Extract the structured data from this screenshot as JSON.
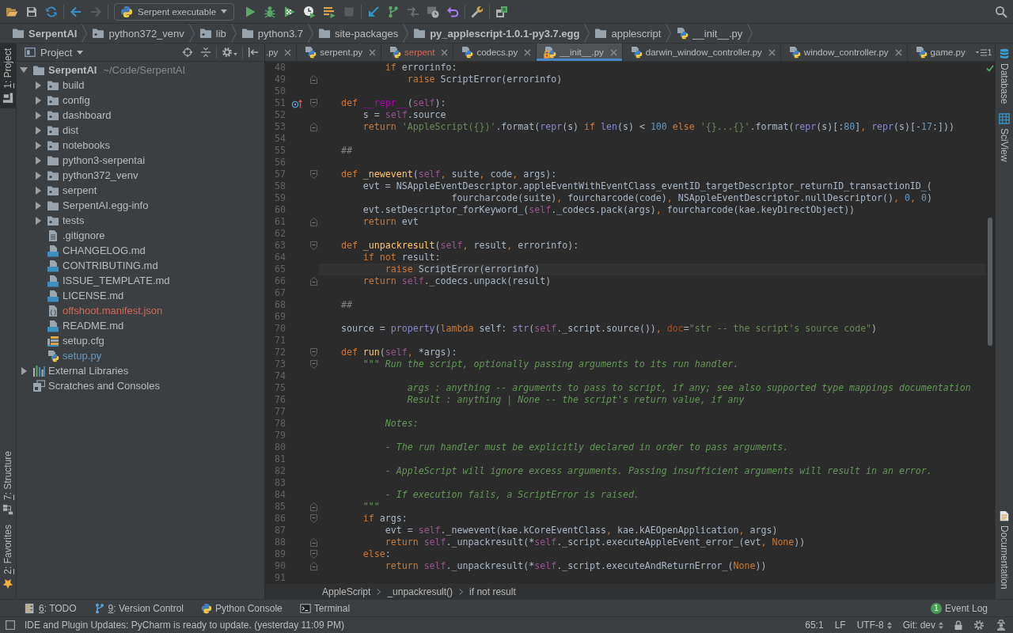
{
  "toolbar": {
    "run_configuration": "Serpent executable",
    "forward_disabled": true,
    "stop_disabled": true
  },
  "navigation_bar": [
    {
      "label": "SerpentAI",
      "kind": "root"
    },
    {
      "label": "python372_venv",
      "kind": "package"
    },
    {
      "label": "lib",
      "kind": "package"
    },
    {
      "label": "python3.7",
      "kind": "folder"
    },
    {
      "label": "site-packages",
      "kind": "folder"
    },
    {
      "label": "py_applescript-1.0.1-py3.7.egg",
      "kind": "root"
    },
    {
      "label": "applescript",
      "kind": "folder"
    },
    {
      "label": "__init__.py",
      "kind": "python"
    }
  ],
  "left_strip": {
    "top": [
      {
        "mnemonic": "1",
        "label": ": Project",
        "kind": "project",
        "selected": true
      }
    ],
    "bottom": [
      {
        "mnemonic": "7",
        "label": ": Structure",
        "kind": "structure",
        "selected": false
      },
      {
        "mnemonic": "2",
        "label": ": Favorites",
        "kind": "favorites",
        "selected": false
      }
    ]
  },
  "project_panel": {
    "title": "Project",
    "tree": [
      {
        "label": "SerpentAI",
        "path": "~/Code/SerpentAI",
        "kind": "root",
        "expanded": true,
        "children": [
          {
            "label": "build",
            "kind": "package",
            "expanded": false
          },
          {
            "label": "config",
            "kind": "package",
            "expanded": false
          },
          {
            "label": "dashboard",
            "kind": "package",
            "expanded": false
          },
          {
            "label": "dist",
            "kind": "package",
            "expanded": false
          },
          {
            "label": "notebooks",
            "kind": "package",
            "expanded": false
          },
          {
            "label": "python3-serpentai",
            "kind": "folder",
            "expanded": false
          },
          {
            "label": "python372_venv",
            "kind": "package",
            "expanded": false
          },
          {
            "label": "serpent",
            "kind": "package",
            "expanded": false
          },
          {
            "label": "SerpentAI.egg-info",
            "kind": "folder",
            "expanded": false
          },
          {
            "label": "tests",
            "kind": "package",
            "expanded": false
          },
          {
            "label": ".gitignore",
            "kind": "text"
          },
          {
            "label": "CHANGELOG.md",
            "kind": "markdown"
          },
          {
            "label": "CONTRIBUTING.md",
            "kind": "markdown"
          },
          {
            "label": "ISSUE_TEMPLATE.md",
            "kind": "markdown"
          },
          {
            "label": "LICENSE.md",
            "kind": "markdown"
          },
          {
            "label": "offshoot.manifest.json",
            "kind": "json",
            "color": "#d1675a"
          },
          {
            "label": "README.md",
            "kind": "markdown"
          },
          {
            "label": "setup.cfg",
            "kind": "config"
          },
          {
            "label": "setup.py",
            "kind": "python",
            "color": "#6897bb"
          }
        ]
      },
      {
        "label": "External Libraries",
        "kind": "libraries",
        "expanded": false
      },
      {
        "label": "Scratches and Consoles",
        "kind": "scratches"
      }
    ]
  },
  "editor": {
    "tabs": [
      {
        "label": ".py",
        "clipped": true,
        "selected": false
      },
      {
        "label": "serpent.py",
        "clipped": false,
        "selected": false,
        "read_only": false
      },
      {
        "label": "serpent",
        "clipped": false,
        "selected": false,
        "read_only": false,
        "color": "#d1675a"
      },
      {
        "label": "codecs.py",
        "clipped": false,
        "selected": false,
        "read_only": false
      },
      {
        "label": "__init__.py",
        "clipped": false,
        "selected": true,
        "read_only": true
      },
      {
        "label": "darwin_window_controller.py",
        "clipped": false,
        "selected": false,
        "read_only": false
      },
      {
        "label": "window_controller.py",
        "clipped": false,
        "selected": false,
        "read_only": false
      },
      {
        "label": "game.py",
        "clipped": false,
        "selected": false,
        "read_only": false
      }
    ],
    "hidden_tabs": "1",
    "lines": [
      {
        "number": "48",
        "current": false,
        "fold_start": false,
        "fold_end": false,
        "overrides": false,
        "tokens": [
          {
            "kind": "keyword",
            "text": "            if "
          },
          {
            "kind": "text",
            "text": "errorinfo:"
          }
        ]
      },
      {
        "number": "49",
        "current": false,
        "fold_start": false,
        "fold_end": true,
        "overrides": false,
        "tokens": [
          {
            "kind": "keyword",
            "text": "                raise "
          },
          {
            "kind": "text",
            "text": "ScriptError(errorinfo)"
          }
        ]
      },
      {
        "number": "50",
        "current": false,
        "fold_start": false,
        "fold_end": false,
        "overrides": false
      },
      {
        "number": "51",
        "current": false,
        "fold_start": true,
        "fold_end": false,
        "overrides": true,
        "tokens": [
          {
            "kind": "keyword",
            "text": "    def "
          },
          {
            "kind": "magic",
            "text": "__repr__"
          },
          {
            "kind": "text",
            "text": "("
          },
          {
            "kind": "self",
            "text": "self"
          },
          {
            "kind": "text",
            "text": "):"
          }
        ]
      },
      {
        "number": "52",
        "current": false,
        "fold_start": false,
        "fold_end": false,
        "overrides": false,
        "tokens": [
          {
            "kind": "text",
            "text": "        s = "
          },
          {
            "kind": "self",
            "text": "self"
          },
          {
            "kind": "text",
            "text": ".source"
          }
        ]
      },
      {
        "number": "53",
        "current": false,
        "fold_start": false,
        "fold_end": true,
        "overrides": false,
        "tokens": [
          {
            "kind": "keyword",
            "text": "        return "
          },
          {
            "kind": "string",
            "text": "'AppleScript({})'"
          },
          {
            "kind": "text",
            "text": ".format("
          },
          {
            "kind": "builtin",
            "text": "repr"
          },
          {
            "kind": "text",
            "text": "(s) "
          },
          {
            "kind": "keyword",
            "text": "if "
          },
          {
            "kind": "builtin",
            "text": "len"
          },
          {
            "kind": "text",
            "text": "(s) < "
          },
          {
            "kind": "number",
            "text": "100"
          },
          {
            "kind": "keyword",
            "text": " else "
          },
          {
            "kind": "string",
            "text": "'{}...{}'"
          },
          {
            "kind": "text",
            "text": ".format("
          },
          {
            "kind": "builtin",
            "text": "repr"
          },
          {
            "kind": "text",
            "text": "(s)[:"
          },
          {
            "kind": "number",
            "text": "80"
          },
          {
            "kind": "text",
            "text": "]"
          },
          {
            "kind": "comma",
            "text": ", "
          },
          {
            "kind": "builtin",
            "text": "repr"
          },
          {
            "kind": "text",
            "text": "(s)[-"
          },
          {
            "kind": "number",
            "text": "17"
          },
          {
            "kind": "text",
            "text": ":]))"
          }
        ]
      },
      {
        "number": "54",
        "current": false,
        "fold_start": false,
        "fold_end": false,
        "overrides": false
      },
      {
        "number": "55",
        "current": false,
        "fold_start": false,
        "fold_end": false,
        "overrides": false,
        "tokens": [
          {
            "kind": "comment",
            "text": "    ##"
          }
        ]
      },
      {
        "number": "56",
        "current": false,
        "fold_start": false,
        "fold_end": false,
        "overrides": false
      },
      {
        "number": "57",
        "current": false,
        "fold_start": true,
        "fold_end": false,
        "overrides": false,
        "tokens": [
          {
            "kind": "keyword",
            "text": "    def "
          },
          {
            "kind": "function",
            "text": "_newevent"
          },
          {
            "kind": "text",
            "text": "("
          },
          {
            "kind": "self",
            "text": "self"
          },
          {
            "kind": "comma",
            "text": ", "
          },
          {
            "kind": "text",
            "text": "suite"
          },
          {
            "kind": "comma",
            "text": ", "
          },
          {
            "kind": "text",
            "text": "code"
          },
          {
            "kind": "comma",
            "text": ", "
          },
          {
            "kind": "text",
            "text": "args):"
          }
        ]
      },
      {
        "number": "58",
        "current": false,
        "fold_start": false,
        "fold_end": false,
        "overrides": false,
        "tokens": [
          {
            "kind": "text",
            "text": "        evt = NSAppleEventDescriptor.appleEventWithEventClass_eventID_targetDescriptor_returnID_transactionID_("
          }
        ]
      },
      {
        "number": "59",
        "current": false,
        "fold_start": false,
        "fold_end": false,
        "overrides": false,
        "tokens": [
          {
            "kind": "text",
            "text": "                        fourcharcode(suite)"
          },
          {
            "kind": "comma",
            "text": ", "
          },
          {
            "kind": "text",
            "text": "fourcharcode(code)"
          },
          {
            "kind": "comma",
            "text": ", "
          },
          {
            "kind": "text",
            "text": "NSAppleEventDescriptor.nullDescriptor()"
          },
          {
            "kind": "comma",
            "text": ", "
          },
          {
            "kind": "number",
            "text": "0"
          },
          {
            "kind": "comma",
            "text": ", "
          },
          {
            "kind": "number",
            "text": "0"
          },
          {
            "kind": "text",
            "text": ")"
          }
        ]
      },
      {
        "number": "60",
        "current": false,
        "fold_start": false,
        "fold_end": false,
        "overrides": false,
        "tokens": [
          {
            "kind": "text",
            "text": "        evt.setDescriptor_forKeyword_("
          },
          {
            "kind": "self",
            "text": "self"
          },
          {
            "kind": "text",
            "text": "._codecs.pack(args)"
          },
          {
            "kind": "comma",
            "text": ", "
          },
          {
            "kind": "text",
            "text": "fourcharcode(kae.keyDirectObject))"
          }
        ]
      },
      {
        "number": "61",
        "current": false,
        "fold_start": false,
        "fold_end": true,
        "overrides": false,
        "tokens": [
          {
            "kind": "keyword",
            "text": "        return "
          },
          {
            "kind": "text",
            "text": "evt"
          }
        ]
      },
      {
        "number": "62",
        "current": false,
        "fold_start": false,
        "fold_end": false,
        "overrides": false
      },
      {
        "number": "63",
        "current": false,
        "fold_start": true,
        "fold_end": false,
        "overrides": false,
        "tokens": [
          {
            "kind": "keyword",
            "text": "    def "
          },
          {
            "kind": "function",
            "text": "_unpackresult"
          },
          {
            "kind": "text",
            "text": "("
          },
          {
            "kind": "self",
            "text": "self"
          },
          {
            "kind": "comma",
            "text": ", "
          },
          {
            "kind": "text",
            "text": "result"
          },
          {
            "kind": "comma",
            "text": ", "
          },
          {
            "kind": "text",
            "text": "errorinfo):"
          }
        ]
      },
      {
        "number": "64",
        "current": false,
        "fold_start": false,
        "fold_end": false,
        "overrides": false,
        "tokens": [
          {
            "kind": "keyword",
            "text": "        if not "
          },
          {
            "kind": "text",
            "text": "result:"
          }
        ]
      },
      {
        "number": "65",
        "current": true,
        "fold_start": false,
        "fold_end": false,
        "overrides": false,
        "tokens": [
          {
            "kind": "keyword",
            "text": "            raise "
          },
          {
            "kind": "text",
            "text": "ScriptError(errorinfo)"
          }
        ]
      },
      {
        "number": "66",
        "current": false,
        "fold_start": false,
        "fold_end": true,
        "overrides": false,
        "tokens": [
          {
            "kind": "keyword",
            "text": "        return "
          },
          {
            "kind": "self",
            "text": "self"
          },
          {
            "kind": "text",
            "text": "._codecs.unpack(result)"
          }
        ]
      },
      {
        "number": "67",
        "current": false,
        "fold_start": false,
        "fold_end": false,
        "overrides": false
      },
      {
        "number": "68",
        "current": false,
        "fold_start": false,
        "fold_end": false,
        "overrides": false,
        "tokens": [
          {
            "kind": "comment",
            "text": "    ##"
          }
        ]
      },
      {
        "number": "69",
        "current": false,
        "fold_start": false,
        "fold_end": false,
        "overrides": false
      },
      {
        "number": "70",
        "current": false,
        "fold_start": false,
        "fold_end": false,
        "overrides": false,
        "tokens": [
          {
            "kind": "text",
            "text": "    source = "
          },
          {
            "kind": "builtin",
            "text": "property"
          },
          {
            "kind": "text",
            "text": "("
          },
          {
            "kind": "keyword",
            "text": "lambda "
          },
          {
            "kind": "text",
            "text": "self: "
          },
          {
            "kind": "builtin",
            "text": "str"
          },
          {
            "kind": "text",
            "text": "("
          },
          {
            "kind": "self",
            "text": "self"
          },
          {
            "kind": "text",
            "text": "._script.source())"
          },
          {
            "kind": "comma",
            "text": ", "
          },
          {
            "kind": "kwarg",
            "text": "doc"
          },
          {
            "kind": "text",
            "text": "="
          },
          {
            "kind": "string",
            "text": "\"str -- the script's source code\""
          },
          {
            "kind": "text",
            "text": ")"
          }
        ]
      },
      {
        "number": "71",
        "current": false,
        "fold_start": false,
        "fold_end": false,
        "overrides": false
      },
      {
        "number": "72",
        "current": false,
        "fold_start": true,
        "fold_end": false,
        "overrides": false,
        "tokens": [
          {
            "kind": "keyword",
            "text": "    def "
          },
          {
            "kind": "function",
            "text": "run"
          },
          {
            "kind": "text",
            "text": "("
          },
          {
            "kind": "self",
            "text": "self"
          },
          {
            "kind": "comma",
            "text": ", "
          },
          {
            "kind": "text",
            "text": "*args):"
          }
        ]
      },
      {
        "number": "73",
        "current": false,
        "fold_start": true,
        "fold_end": false,
        "overrides": false,
        "tokens": [
          {
            "kind": "docstring",
            "text": "        \"\"\" Run the script, optionally passing arguments to its run handler."
          }
        ]
      },
      {
        "number": "74",
        "current": false,
        "fold_start": false,
        "fold_end": false,
        "overrides": false
      },
      {
        "number": "75",
        "current": false,
        "fold_start": false,
        "fold_end": false,
        "overrides": false,
        "tokens": [
          {
            "kind": "docstring",
            "text": "                args : anything -- arguments to pass to script, if any; see also supported type mappings documentation"
          }
        ]
      },
      {
        "number": "76",
        "current": false,
        "fold_start": false,
        "fold_end": false,
        "overrides": false,
        "tokens": [
          {
            "kind": "docstring",
            "text": "                Result : anything | None -- the script's return value, if any"
          }
        ]
      },
      {
        "number": "77",
        "current": false,
        "fold_start": false,
        "fold_end": false,
        "overrides": false
      },
      {
        "number": "78",
        "current": false,
        "fold_start": false,
        "fold_end": false,
        "overrides": false,
        "tokens": [
          {
            "kind": "docstring",
            "text": "            Notes:"
          }
        ]
      },
      {
        "number": "79",
        "current": false,
        "fold_start": false,
        "fold_end": false,
        "overrides": false
      },
      {
        "number": "80",
        "current": false,
        "fold_start": false,
        "fold_end": false,
        "overrides": false,
        "tokens": [
          {
            "kind": "docstring",
            "text": "            - The run handler must be explicitly declared in order to pass arguments."
          }
        ]
      },
      {
        "number": "81",
        "current": false,
        "fold_start": false,
        "fold_end": false,
        "overrides": false
      },
      {
        "number": "82",
        "current": false,
        "fold_start": false,
        "fold_end": false,
        "overrides": false,
        "tokens": [
          {
            "kind": "docstring",
            "text": "            - AppleScript will ignore excess arguments. Passing insufficient arguments will result in an error."
          }
        ]
      },
      {
        "number": "83",
        "current": false,
        "fold_start": false,
        "fold_end": false,
        "overrides": false
      },
      {
        "number": "84",
        "current": false,
        "fold_start": false,
        "fold_end": false,
        "overrides": false,
        "tokens": [
          {
            "kind": "docstring",
            "text": "            - If execution fails, a ScriptError is raised."
          }
        ]
      },
      {
        "number": "85",
        "current": false,
        "fold_start": false,
        "fold_end": true,
        "overrides": false,
        "tokens": [
          {
            "kind": "docstring",
            "text": "        \"\"\""
          }
        ]
      },
      {
        "number": "86",
        "current": false,
        "fold_start": true,
        "fold_end": false,
        "overrides": false,
        "tokens": [
          {
            "kind": "keyword",
            "text": "        if "
          },
          {
            "kind": "text",
            "text": "args:"
          }
        ]
      },
      {
        "number": "87",
        "current": false,
        "fold_start": false,
        "fold_end": false,
        "overrides": false,
        "tokens": [
          {
            "kind": "text",
            "text": "            evt = "
          },
          {
            "kind": "self",
            "text": "self"
          },
          {
            "kind": "text",
            "text": "._newevent(kae.kCoreEventClass"
          },
          {
            "kind": "comma",
            "text": ", "
          },
          {
            "kind": "text",
            "text": "kae.kAEOpenApplication"
          },
          {
            "kind": "comma",
            "text": ", "
          },
          {
            "kind": "text",
            "text": "args)"
          }
        ]
      },
      {
        "number": "88",
        "current": false,
        "fold_start": false,
        "fold_end": true,
        "overrides": false,
        "tokens": [
          {
            "kind": "keyword",
            "text": "            return "
          },
          {
            "kind": "self",
            "text": "self"
          },
          {
            "kind": "text",
            "text": "._unpackresult(*"
          },
          {
            "kind": "self",
            "text": "self"
          },
          {
            "kind": "text",
            "text": "._script.executeAppleEvent_error_(evt"
          },
          {
            "kind": "comma",
            "text": ", "
          },
          {
            "kind": "keyword",
            "text": "None"
          },
          {
            "kind": "text",
            "text": "))"
          }
        ]
      },
      {
        "number": "89",
        "current": false,
        "fold_start": true,
        "fold_end": false,
        "overrides": false,
        "tokens": [
          {
            "kind": "keyword",
            "text": "        else"
          },
          {
            "kind": "text",
            "text": ":"
          }
        ]
      },
      {
        "number": "90",
        "current": false,
        "fold_start": false,
        "fold_end": true,
        "overrides": false,
        "tokens": [
          {
            "kind": "keyword",
            "text": "            return "
          },
          {
            "kind": "self",
            "text": "self"
          },
          {
            "kind": "text",
            "text": "._unpackresult(*"
          },
          {
            "kind": "self",
            "text": "self"
          },
          {
            "kind": "text",
            "text": "._script.executeAndReturnError_("
          },
          {
            "kind": "keyword",
            "text": "None"
          },
          {
            "kind": "text",
            "text": "))"
          }
        ]
      },
      {
        "number": "91",
        "current": false,
        "fold_start": false,
        "fold_end": false,
        "overrides": false
      }
    ],
    "breadcrumbs": [
      "AppleScript",
      "_unpackresult()",
      "if not result"
    ]
  },
  "right_strip": {
    "top": [
      {
        "label": "Database",
        "kind": "database"
      },
      {
        "label": "SciView",
        "kind": "sciview"
      }
    ],
    "bottom": [
      {
        "label": "Documentation",
        "kind": "documentation"
      }
    ]
  },
  "tool_windows": [
    {
      "mnemonic": "6",
      "label": ": TODO",
      "kind": "todo"
    },
    {
      "mnemonic": "9",
      "label": ": Version Control",
      "kind": "vcs"
    },
    {
      "label": "Python Console",
      "kind": "console"
    },
    {
      "label": "Terminal",
      "kind": "terminal"
    }
  ],
  "event_log": {
    "label": "Event Log",
    "count": "1"
  },
  "status_bar": {
    "message": "IDE and Plugin Updates: PyCharm is ready to update. (yesterday 11:09 PM)",
    "caret_position": "65:1",
    "line_separator": "LF",
    "encoding": "UTF-8",
    "vcs_branch": "Git: dev"
  }
}
